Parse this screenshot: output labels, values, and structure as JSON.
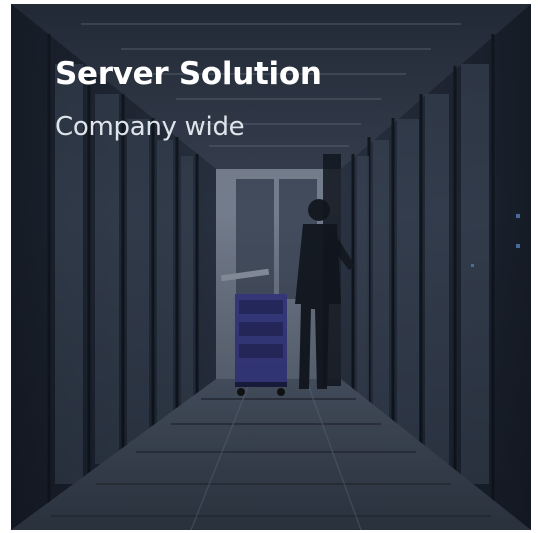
{
  "card": {
    "title": "Server Solution",
    "subtitle": "Company wide",
    "image_subject": "server-room-photo"
  },
  "colors": {
    "title": "#ffffff",
    "subtitle": "#dfe3ea",
    "background_dark": "#1f2733",
    "floor": "#4a5563",
    "cart": "#3a3a8c"
  }
}
